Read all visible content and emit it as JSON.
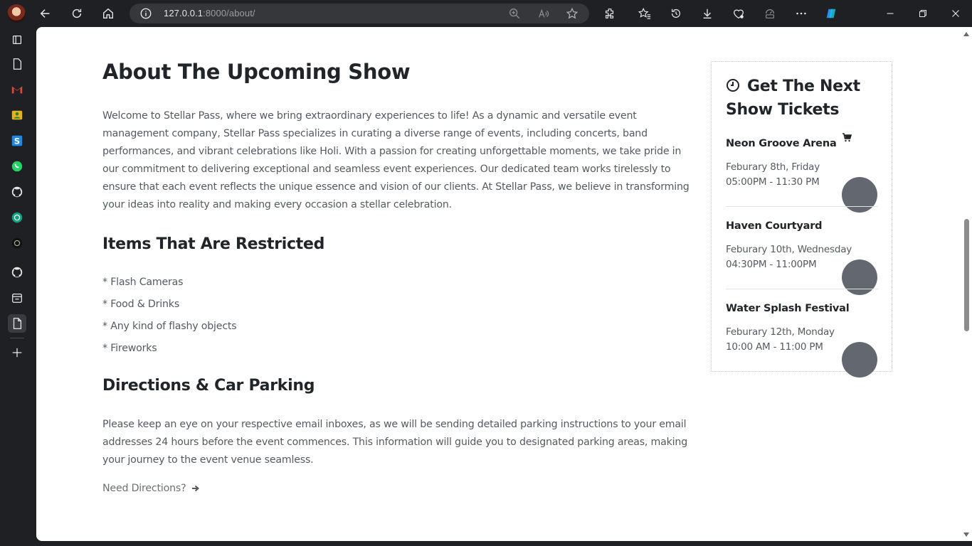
{
  "browser": {
    "url_host": "127.0.0.1",
    "url_rest": ":8000/about/"
  },
  "about": {
    "title": "About The Upcoming Show",
    "intro": "Welcome to Stellar Pass, where we bring extraordinary experiences to life! As a dynamic and versatile event management company, Stellar Pass specializes in curating a diverse range of events, including concerts, band performances, and vibrant celebrations like Holi. With a passion for creating unforgettable moments, we take pride in our commitment to delivering exceptional and seamless event experiences. Our dedicated team works tirelessly to ensure that each event reflects the unique essence and vision of our clients. At Stellar Pass, we believe in transforming your ideas into reality and making every occasion a stellar celebration."
  },
  "restricted": {
    "heading": "Items That Are Restricted",
    "items": [
      "* Flash Cameras",
      "* Food & Drinks",
      "* Any kind of flashy objects",
      "* Fireworks"
    ]
  },
  "directions": {
    "heading": "Directions & Car Parking",
    "text": "Please keep an eye on your respective email inboxes, as we will be sending detailed parking instructions to your email addresses 24 hours before the event commences. This information will guide you to designated parking areas, making your journey to the event venue seamless.",
    "link_label": "Need Directions?"
  },
  "tickets": {
    "title": "Get The Next Show Tickets",
    "events": [
      {
        "name": "Neon Groove Arena",
        "date": "Feburary 8th, Friday",
        "time": "05:00PM - 11:30 PM"
      },
      {
        "name": "Haven Courtyard",
        "date": "Feburary 10th, Wednesday",
        "time": "04:30PM - 11:00PM"
      },
      {
        "name": "Water Splash Festival",
        "date": "Feburary 12th, Monday",
        "time": "10:00 AM - 11:00 PM"
      }
    ]
  },
  "icons": {
    "sidebar": [
      "tabs-icon",
      "document-icon",
      "gmail-icon",
      "photos-icon",
      "s-app-icon",
      "whatsapp-icon",
      "github-icon",
      "chatgpt-icon",
      "dark-app-icon",
      "github-icon",
      "calendar-icon",
      "page-icon",
      "add-icon"
    ]
  },
  "colors": {
    "heading": "#212529",
    "body_text": "#555a60",
    "thumb": "#636870",
    "browser_chrome": "#1f2024"
  }
}
